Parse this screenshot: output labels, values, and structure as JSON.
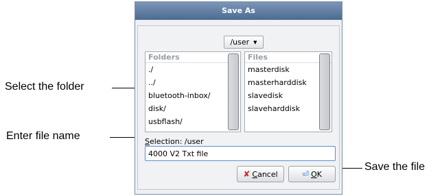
{
  "dialog": {
    "title": "Save As",
    "current_dir": "/user",
    "folders_header": "Folders",
    "folders": [
      "./",
      "../",
      "bluetooth-inbox/",
      "disk/",
      "usbflash/"
    ],
    "files_header": "Files",
    "files": [
      "masterdisk",
      "masterharddisk",
      "slavedisk",
      "slaveharddisk"
    ],
    "selection_prefix": "S",
    "selection_rest": "election: /user",
    "filename_value": "4000 V2 Txt file",
    "cancel_mnemonic": "C",
    "cancel_rest": "ancel",
    "ok_mnemonic": "O",
    "ok_rest": "K"
  },
  "annotations": {
    "select_folder": "Select the folder",
    "enter_file_name": "Enter file name",
    "save_file": "Save the file"
  }
}
